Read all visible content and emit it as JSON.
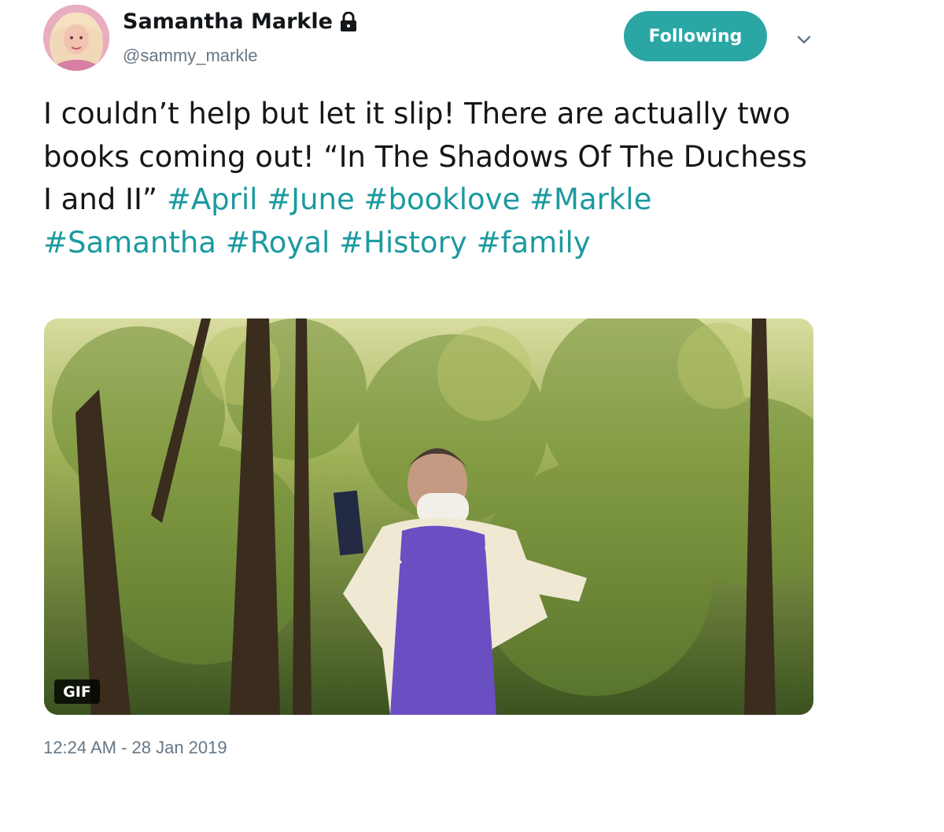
{
  "author": {
    "name": "Samantha Markle",
    "handle": "@sammy_markle",
    "protected_icon": "lock-icon",
    "avatar_icon": "avatar"
  },
  "follow_button": {
    "label": "Following",
    "color": "#2aa7a5"
  },
  "menu_icon": "chevron-down-icon",
  "tweet": {
    "text": "I couldn’t help but let it slip! There are actually two books coming out! “In The Shadows Of The Duchess I and II”",
    "hashtags": [
      "#April",
      "#June",
      "#booklove",
      "#Markle",
      "#Samantha",
      "#Royal",
      "#History",
      "#family"
    ],
    "hashtag_color": "#1b9aa0"
  },
  "media": {
    "badge": "GIF"
  },
  "timestamp": "12:24 AM - 28 Jan 2019"
}
